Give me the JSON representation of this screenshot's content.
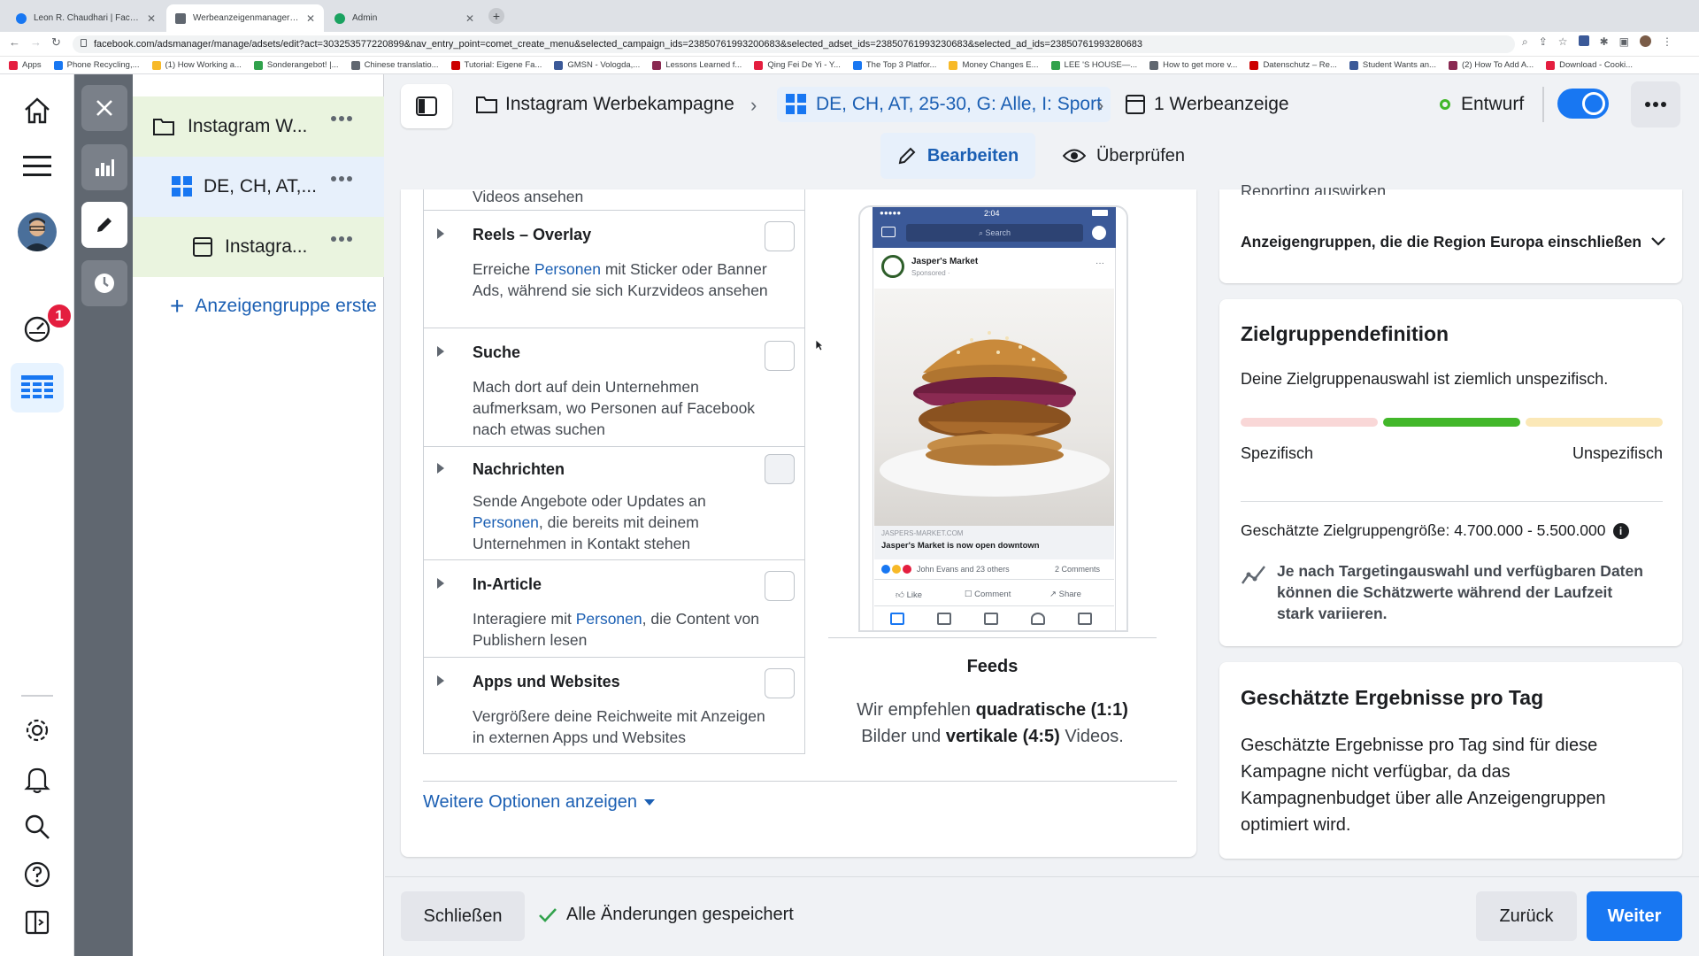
{
  "browser": {
    "tabs": [
      {
        "title": "Leon R. Chaudhari | Facebook",
        "color": "#1877f2"
      },
      {
        "title": "Werbeanzeigenmanager - Wer",
        "color": "#606770"
      },
      {
        "title": "Admin",
        "color": "#1aa260"
      }
    ],
    "url": "facebook.com/adsmanager/manage/adsets/edit?act=303253577220899&nav_entry_point=comet_create_menu&selected_campaign_ids=23850761993200683&selected_adset_ids=23850761993230683&selected_ad_ids=23850761993280683",
    "bookmarks": [
      "Apps",
      "Phone Recycling,...",
      "(1) How Working a...",
      "Sonderangebot! |...",
      "Chinese translatio...",
      "Tutorial: Eigene Fa...",
      "GMSN - Vologda,...",
      "Lessons Learned f...",
      "Qing Fei De Yi - Y...",
      "The Top 3 Platfor...",
      "Money Changes E...",
      "LEE 'S HOUSE—...",
      "How to get more v...",
      "Datenschutz – Re...",
      "Student Wants an...",
      "(2) How To Add A...",
      "Download - Cooki..."
    ]
  },
  "rail": {
    "badge": "1"
  },
  "tree": {
    "campaign": "Instagram W...",
    "adset": "DE, CH, AT,...",
    "ad": "Instagra...",
    "create": "Anzeigengruppe erste"
  },
  "header": {
    "campaign": "Instagram Werbekampagne",
    "adset": "DE, CH, AT, 25-30, G: Alle, I: Sport",
    "ads": "1 Werbeanzeige",
    "status": "Entwurf",
    "edit": "Bearbeiten",
    "review": "Überprüfen"
  },
  "placements": {
    "partial": "Videos ansehen",
    "items": [
      {
        "title": "Reels – Overlay",
        "desc_pre": "Erreiche ",
        "desc_link": "Personen",
        "desc_post": " mit Sticker oder Banner Ads, während sie sich Kurzvideos ansehen"
      },
      {
        "title": "Suche",
        "desc_pre": "Mach dort auf dein Unternehmen aufmerksam, wo Personen auf Facebook nach etwas suchen",
        "desc_link": "",
        "desc_post": ""
      },
      {
        "title": "Nachrichten",
        "desc_pre": "Sende Angebote oder Updates an ",
        "desc_link": "Personen",
        "desc_post": ", die bereits mit deinem Unternehmen in Kontakt stehen"
      },
      {
        "title": "In-Article",
        "desc_pre": "Interagiere mit ",
        "desc_link": "Personen",
        "desc_post": ", die Content von Publishern lesen"
      },
      {
        "title": "Apps und Websites",
        "desc_pre": "Vergrößere deine Reichweite mit Anzeigen in externen Apps und Websites",
        "desc_link": "",
        "desc_post": ""
      }
    ],
    "more": "Weitere Optionen anzeigen"
  },
  "preview": {
    "time": "2:04",
    "search": "Search",
    "page": "Jasper's Market",
    "sponsored": "Sponsored · ",
    "domain": "JASPERS-MARKET.COM",
    "headline": "Jasper's Market is now open downtown",
    "reactions": "John Evans and 23 others",
    "comments": "2 Comments",
    "like": "Like",
    "comment": "Comment",
    "share": "Share",
    "label": "Feeds",
    "rec_1": "Wir empfehlen ",
    "rec_b1": "quadratische (1:1)",
    "rec_2": "Bilder und ",
    "rec_b2": "vertikale (4:5)",
    "rec_3": " Videos."
  },
  "right": {
    "partial": "Reporting auswirken",
    "region": "Anzeigengruppen, die die Region Europa einschließen",
    "audience_title": "Zielgruppendefinition",
    "audience_desc": "Deine Zielgruppenauswahl ist ziemlich unspezifisch.",
    "specific": "Spezifisch",
    "unspecific": "Unspezifisch",
    "size": "Geschätzte Zielgruppengröße: 4.700.000 - 5.500.000",
    "note": "Je nach Targetingauswahl und verfügbaren Daten können die Schätzwerte während der Laufzeit stark variieren.",
    "results_title": "Geschätzte Ergebnisse pro Tag",
    "results_desc": "Geschätzte Ergebnisse pro Tag sind für diese Kampagne nicht verfügbar, da das Kampagnenbudget über alle Anzeigengruppen optimiert wird."
  },
  "footer": {
    "close": "Schließen",
    "saved": "Alle Änderungen gespeichert",
    "back": "Zurück",
    "next": "Weiter"
  },
  "colors": {
    "primary": "#1877f2",
    "green": "#42b72a",
    "draft": "#42b72a"
  }
}
